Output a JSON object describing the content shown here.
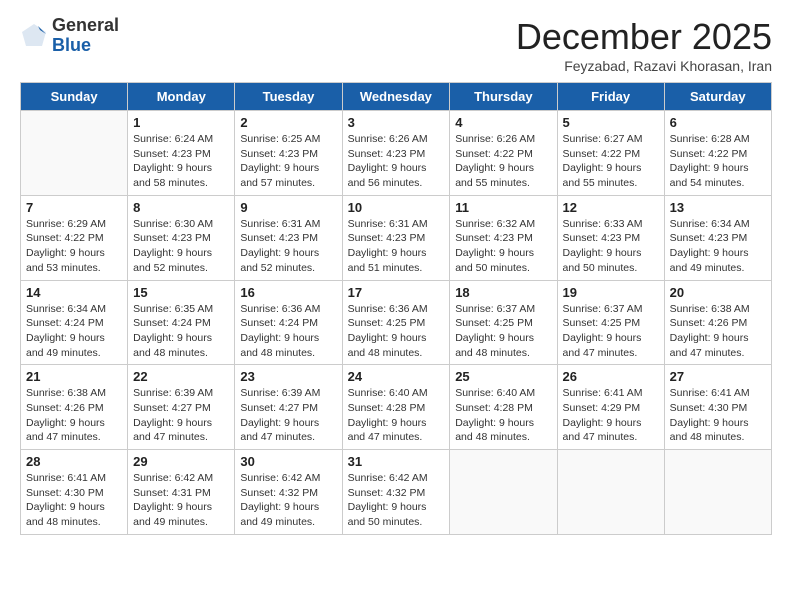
{
  "logo": {
    "general": "General",
    "blue": "Blue"
  },
  "header": {
    "month": "December 2025",
    "location": "Feyzabad, Razavi Khorasan, Iran"
  },
  "weekdays": [
    "Sunday",
    "Monday",
    "Tuesday",
    "Wednesday",
    "Thursday",
    "Friday",
    "Saturday"
  ],
  "weeks": [
    [
      {
        "day": "",
        "sunrise": "",
        "sunset": "",
        "daylight": ""
      },
      {
        "day": "1",
        "sunrise": "Sunrise: 6:24 AM",
        "sunset": "Sunset: 4:23 PM",
        "daylight": "Daylight: 9 hours and 58 minutes."
      },
      {
        "day": "2",
        "sunrise": "Sunrise: 6:25 AM",
        "sunset": "Sunset: 4:23 PM",
        "daylight": "Daylight: 9 hours and 57 minutes."
      },
      {
        "day": "3",
        "sunrise": "Sunrise: 6:26 AM",
        "sunset": "Sunset: 4:23 PM",
        "daylight": "Daylight: 9 hours and 56 minutes."
      },
      {
        "day": "4",
        "sunrise": "Sunrise: 6:26 AM",
        "sunset": "Sunset: 4:22 PM",
        "daylight": "Daylight: 9 hours and 55 minutes."
      },
      {
        "day": "5",
        "sunrise": "Sunrise: 6:27 AM",
        "sunset": "Sunset: 4:22 PM",
        "daylight": "Daylight: 9 hours and 55 minutes."
      },
      {
        "day": "6",
        "sunrise": "Sunrise: 6:28 AM",
        "sunset": "Sunset: 4:22 PM",
        "daylight": "Daylight: 9 hours and 54 minutes."
      }
    ],
    [
      {
        "day": "7",
        "sunrise": "Sunrise: 6:29 AM",
        "sunset": "Sunset: 4:22 PM",
        "daylight": "Daylight: 9 hours and 53 minutes."
      },
      {
        "day": "8",
        "sunrise": "Sunrise: 6:30 AM",
        "sunset": "Sunset: 4:23 PM",
        "daylight": "Daylight: 9 hours and 52 minutes."
      },
      {
        "day": "9",
        "sunrise": "Sunrise: 6:31 AM",
        "sunset": "Sunset: 4:23 PM",
        "daylight": "Daylight: 9 hours and 52 minutes."
      },
      {
        "day": "10",
        "sunrise": "Sunrise: 6:31 AM",
        "sunset": "Sunset: 4:23 PM",
        "daylight": "Daylight: 9 hours and 51 minutes."
      },
      {
        "day": "11",
        "sunrise": "Sunrise: 6:32 AM",
        "sunset": "Sunset: 4:23 PM",
        "daylight": "Daylight: 9 hours and 50 minutes."
      },
      {
        "day": "12",
        "sunrise": "Sunrise: 6:33 AM",
        "sunset": "Sunset: 4:23 PM",
        "daylight": "Daylight: 9 hours and 50 minutes."
      },
      {
        "day": "13",
        "sunrise": "Sunrise: 6:34 AM",
        "sunset": "Sunset: 4:23 PM",
        "daylight": "Daylight: 9 hours and 49 minutes."
      }
    ],
    [
      {
        "day": "14",
        "sunrise": "Sunrise: 6:34 AM",
        "sunset": "Sunset: 4:24 PM",
        "daylight": "Daylight: 9 hours and 49 minutes."
      },
      {
        "day": "15",
        "sunrise": "Sunrise: 6:35 AM",
        "sunset": "Sunset: 4:24 PM",
        "daylight": "Daylight: 9 hours and 48 minutes."
      },
      {
        "day": "16",
        "sunrise": "Sunrise: 6:36 AM",
        "sunset": "Sunset: 4:24 PM",
        "daylight": "Daylight: 9 hours and 48 minutes."
      },
      {
        "day": "17",
        "sunrise": "Sunrise: 6:36 AM",
        "sunset": "Sunset: 4:25 PM",
        "daylight": "Daylight: 9 hours and 48 minutes."
      },
      {
        "day": "18",
        "sunrise": "Sunrise: 6:37 AM",
        "sunset": "Sunset: 4:25 PM",
        "daylight": "Daylight: 9 hours and 48 minutes."
      },
      {
        "day": "19",
        "sunrise": "Sunrise: 6:37 AM",
        "sunset": "Sunset: 4:25 PM",
        "daylight": "Daylight: 9 hours and 47 minutes."
      },
      {
        "day": "20",
        "sunrise": "Sunrise: 6:38 AM",
        "sunset": "Sunset: 4:26 PM",
        "daylight": "Daylight: 9 hours and 47 minutes."
      }
    ],
    [
      {
        "day": "21",
        "sunrise": "Sunrise: 6:38 AM",
        "sunset": "Sunset: 4:26 PM",
        "daylight": "Daylight: 9 hours and 47 minutes."
      },
      {
        "day": "22",
        "sunrise": "Sunrise: 6:39 AM",
        "sunset": "Sunset: 4:27 PM",
        "daylight": "Daylight: 9 hours and 47 minutes."
      },
      {
        "day": "23",
        "sunrise": "Sunrise: 6:39 AM",
        "sunset": "Sunset: 4:27 PM",
        "daylight": "Daylight: 9 hours and 47 minutes."
      },
      {
        "day": "24",
        "sunrise": "Sunrise: 6:40 AM",
        "sunset": "Sunset: 4:28 PM",
        "daylight": "Daylight: 9 hours and 47 minutes."
      },
      {
        "day": "25",
        "sunrise": "Sunrise: 6:40 AM",
        "sunset": "Sunset: 4:28 PM",
        "daylight": "Daylight: 9 hours and 48 minutes."
      },
      {
        "day": "26",
        "sunrise": "Sunrise: 6:41 AM",
        "sunset": "Sunset: 4:29 PM",
        "daylight": "Daylight: 9 hours and 47 minutes."
      },
      {
        "day": "27",
        "sunrise": "Sunrise: 6:41 AM",
        "sunset": "Sunset: 4:30 PM",
        "daylight": "Daylight: 9 hours and 48 minutes."
      }
    ],
    [
      {
        "day": "28",
        "sunrise": "Sunrise: 6:41 AM",
        "sunset": "Sunset: 4:30 PM",
        "daylight": "Daylight: 9 hours and 48 minutes."
      },
      {
        "day": "29",
        "sunrise": "Sunrise: 6:42 AM",
        "sunset": "Sunset: 4:31 PM",
        "daylight": "Daylight: 9 hours and 49 minutes."
      },
      {
        "day": "30",
        "sunrise": "Sunrise: 6:42 AM",
        "sunset": "Sunset: 4:32 PM",
        "daylight": "Daylight: 9 hours and 49 minutes."
      },
      {
        "day": "31",
        "sunrise": "Sunrise: 6:42 AM",
        "sunset": "Sunset: 4:32 PM",
        "daylight": "Daylight: 9 hours and 50 minutes."
      },
      {
        "day": "",
        "sunrise": "",
        "sunset": "",
        "daylight": ""
      },
      {
        "day": "",
        "sunrise": "",
        "sunset": "",
        "daylight": ""
      },
      {
        "day": "",
        "sunrise": "",
        "sunset": "",
        "daylight": ""
      }
    ]
  ]
}
